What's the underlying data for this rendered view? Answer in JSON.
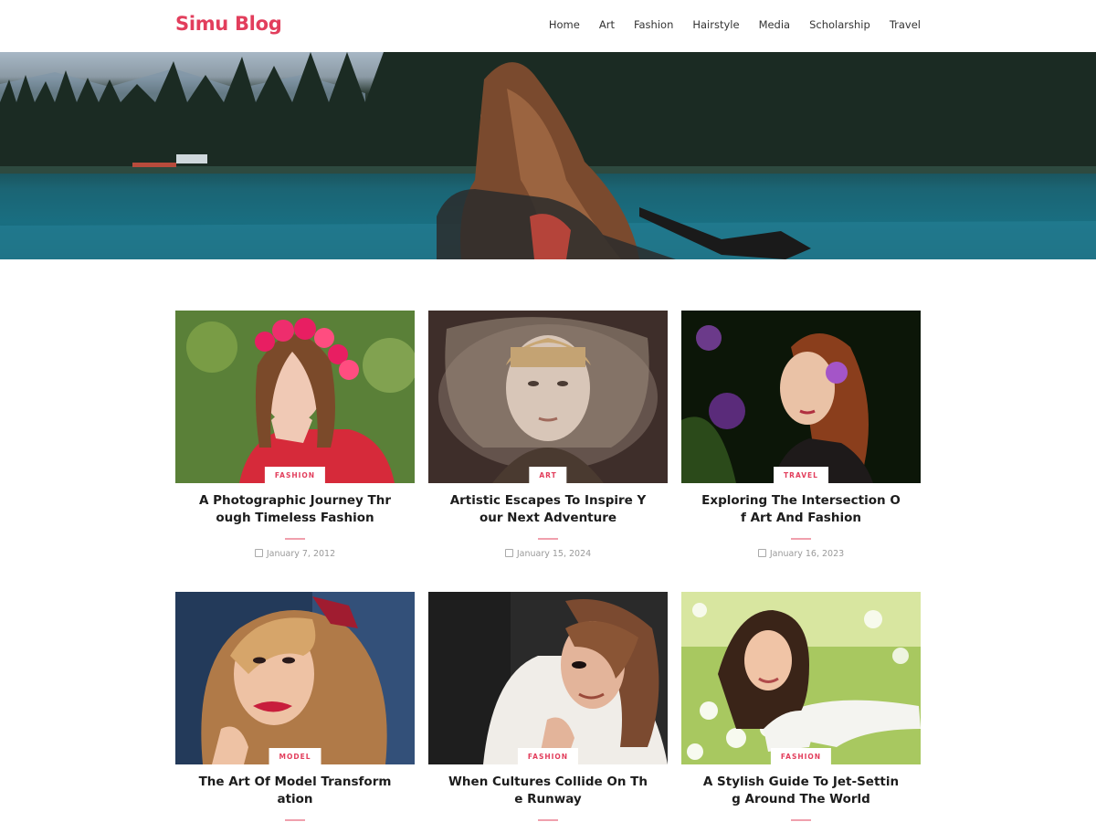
{
  "header": {
    "logo": "Simu Blog",
    "nav": [
      "Home",
      "Art",
      "Fashion",
      "Hairstyle",
      "Media",
      "Scholarship",
      "Travel"
    ]
  },
  "posts": [
    {
      "category": "FASHION",
      "title": "A Photographic Journey Through Timeless Fashion",
      "date": "January 7, 2012"
    },
    {
      "category": "ART",
      "title": "Artistic Escapes To Inspire Your Next Adventure",
      "date": "January 15, 2024"
    },
    {
      "category": "TRAVEL",
      "title": "Exploring The Intersection Of Art And Fashion",
      "date": "January 16, 2023"
    },
    {
      "category": "MODEL",
      "title": "The Art Of Model Transformation",
      "date": ""
    },
    {
      "category": "FASHION",
      "title": "When Cultures Collide On The Runway",
      "date": ""
    },
    {
      "category": "FASHION",
      "title": "A Stylish Guide To Jet-Setting Around The World",
      "date": ""
    }
  ],
  "colors": {
    "accent": "#e23e5c"
  }
}
